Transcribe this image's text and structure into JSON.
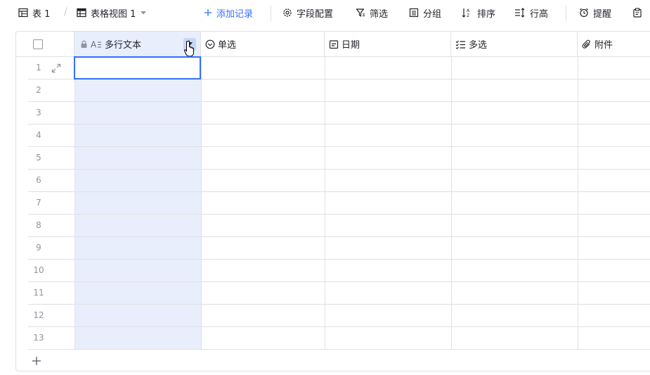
{
  "toolbar": {
    "table_tab": "表 1",
    "view_tab": "表格视图 1",
    "add_record": "添加记录",
    "field_config": "字段配置",
    "filter": "筛选",
    "group": "分组",
    "sort": "排序",
    "row_height": "行高",
    "reminder": "提醒"
  },
  "columns": [
    {
      "label": "多行文本",
      "icon": "multiline-text-icon",
      "locked": true,
      "selected": true
    },
    {
      "label": "单选",
      "icon": "single-select-icon"
    },
    {
      "label": "日期",
      "icon": "date-icon"
    },
    {
      "label": "多选",
      "icon": "multi-select-icon"
    },
    {
      "label": "附件",
      "icon": "attachment-icon"
    }
  ],
  "rows": [
    "1",
    "2",
    "3",
    "4",
    "5",
    "6",
    "7",
    "8",
    "9",
    "10",
    "11",
    "12",
    "13"
  ],
  "colors": {
    "accent": "#3370ff",
    "selected_column": "#e8eefc",
    "border": "#dee0e3"
  }
}
